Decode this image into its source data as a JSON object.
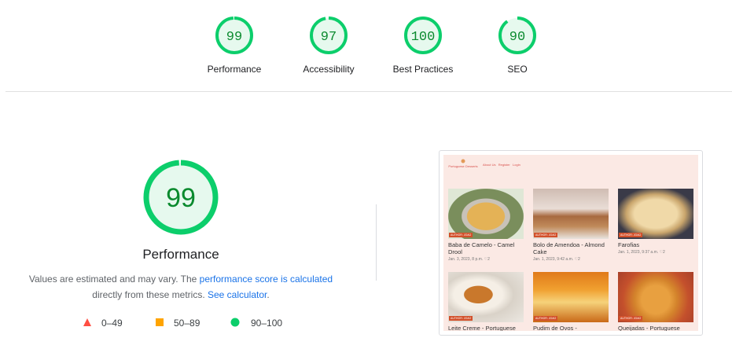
{
  "colors": {
    "pass": "#0cce6b",
    "pass_text": "#0a8a2e",
    "pass_fill": "#e6f9ee",
    "average": "#ffa400",
    "fail": "#ff4e42",
    "link": "#1a73e8"
  },
  "summary": [
    {
      "label": "Performance",
      "score": "99",
      "value": 99
    },
    {
      "label": "Accessibility",
      "score": "97",
      "value": 97
    },
    {
      "label": "Best Practices",
      "score": "100",
      "value": 100
    },
    {
      "label": "SEO",
      "score": "90",
      "value": 90
    }
  ],
  "main": {
    "score": "99",
    "value": 99,
    "title": "Performance",
    "desc_before": "Values are estimated and may vary. The ",
    "link_score": "performance score is calculated",
    "desc_middle": " directly from these metrics. ",
    "link_calc": "See calculator",
    "desc_after": "."
  },
  "legend": [
    {
      "icon": "fail-triangle-icon",
      "range": "0–49"
    },
    {
      "icon": "average-square-icon",
      "range": "50–89"
    },
    {
      "icon": "pass-circle-icon",
      "range": "90–100"
    }
  ],
  "screenshot": {
    "site_name": "Portuguese Desserts",
    "nav": [
      "About Us",
      "Register",
      "Login"
    ],
    "cards": [
      {
        "title": "Baba de Camelo - Camel Drool",
        "meta": "Jan. 3, 2023, 8 p.m. ♡2",
        "tag": "AUTHOR: JOAO"
      },
      {
        "title": "Bolo de Amendoa - Almond Cake",
        "meta": "Jan. 1, 2023, 9:42 a.m. ♡2",
        "tag": "AUTHOR: JOAO"
      },
      {
        "title": "Farofias",
        "meta": "Jan. 1, 2023, 9:37 a.m. ♡2",
        "tag": "AUTHOR: JOAO"
      },
      {
        "title": "Leite Creme - Portuguese",
        "meta": "",
        "tag": "AUTHOR: JOAO"
      },
      {
        "title": "Pudim de Ovos - Portuguese Egg Pudding",
        "meta": "",
        "tag": "AUTHOR: JOAO"
      },
      {
        "title": "Queijadas - Portuguese Cheesecake Tarts",
        "meta": "",
        "tag": "AUTHOR: JOAO"
      }
    ]
  }
}
